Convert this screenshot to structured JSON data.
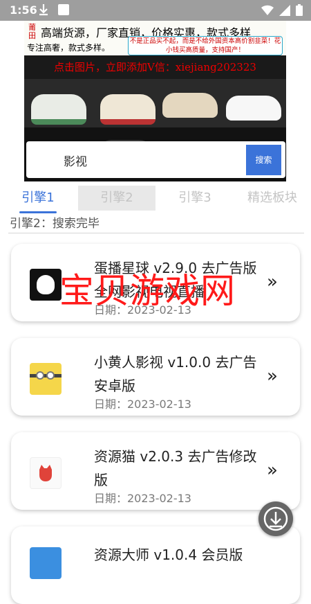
{
  "status_bar": {
    "time": "1:56"
  },
  "banner": {
    "seal": "莆田",
    "headline": "高端货源，厂家直销，价格实惠，款式多样",
    "subline": "专注高奢，款式多样。",
    "notice": "不是正品买不起，而是不给外国资本高价割韭菜！花小钱买高质量，支持国产！",
    "cta": "点击图片，立即添加V信：xiejiang202323"
  },
  "search": {
    "value": "影视",
    "button_label": "搜索"
  },
  "tabs": [
    {
      "label": "引擎1"
    },
    {
      "label": "引擎2"
    },
    {
      "label": "引擎3"
    },
    {
      "label": "精选板块"
    }
  ],
  "search_status": "引擎2：搜索完毕",
  "results": [
    {
      "title": "蛋播星球 v2.9.0 去广告版 全网影视电视直播",
      "date": "日期：2023-02-13",
      "icon": "egg-app-icon"
    },
    {
      "title": "小黄人影视 v1.0.0 去广告安卓版",
      "date": "日期：2023-02-13",
      "icon": "minion-app-icon"
    },
    {
      "title": "资源猫 v2.0.3 去广告修改版",
      "date": "日期：2023-02-13",
      "icon": "cat-app-icon"
    },
    {
      "title": "资源大师 v1.0.4 会员版",
      "date": "",
      "icon": "app-icon"
    }
  ],
  "watermark": "宝贝游戏网",
  "colors": {
    "accent": "#3b73d9",
    "watermark": "#ff1a1a"
  }
}
